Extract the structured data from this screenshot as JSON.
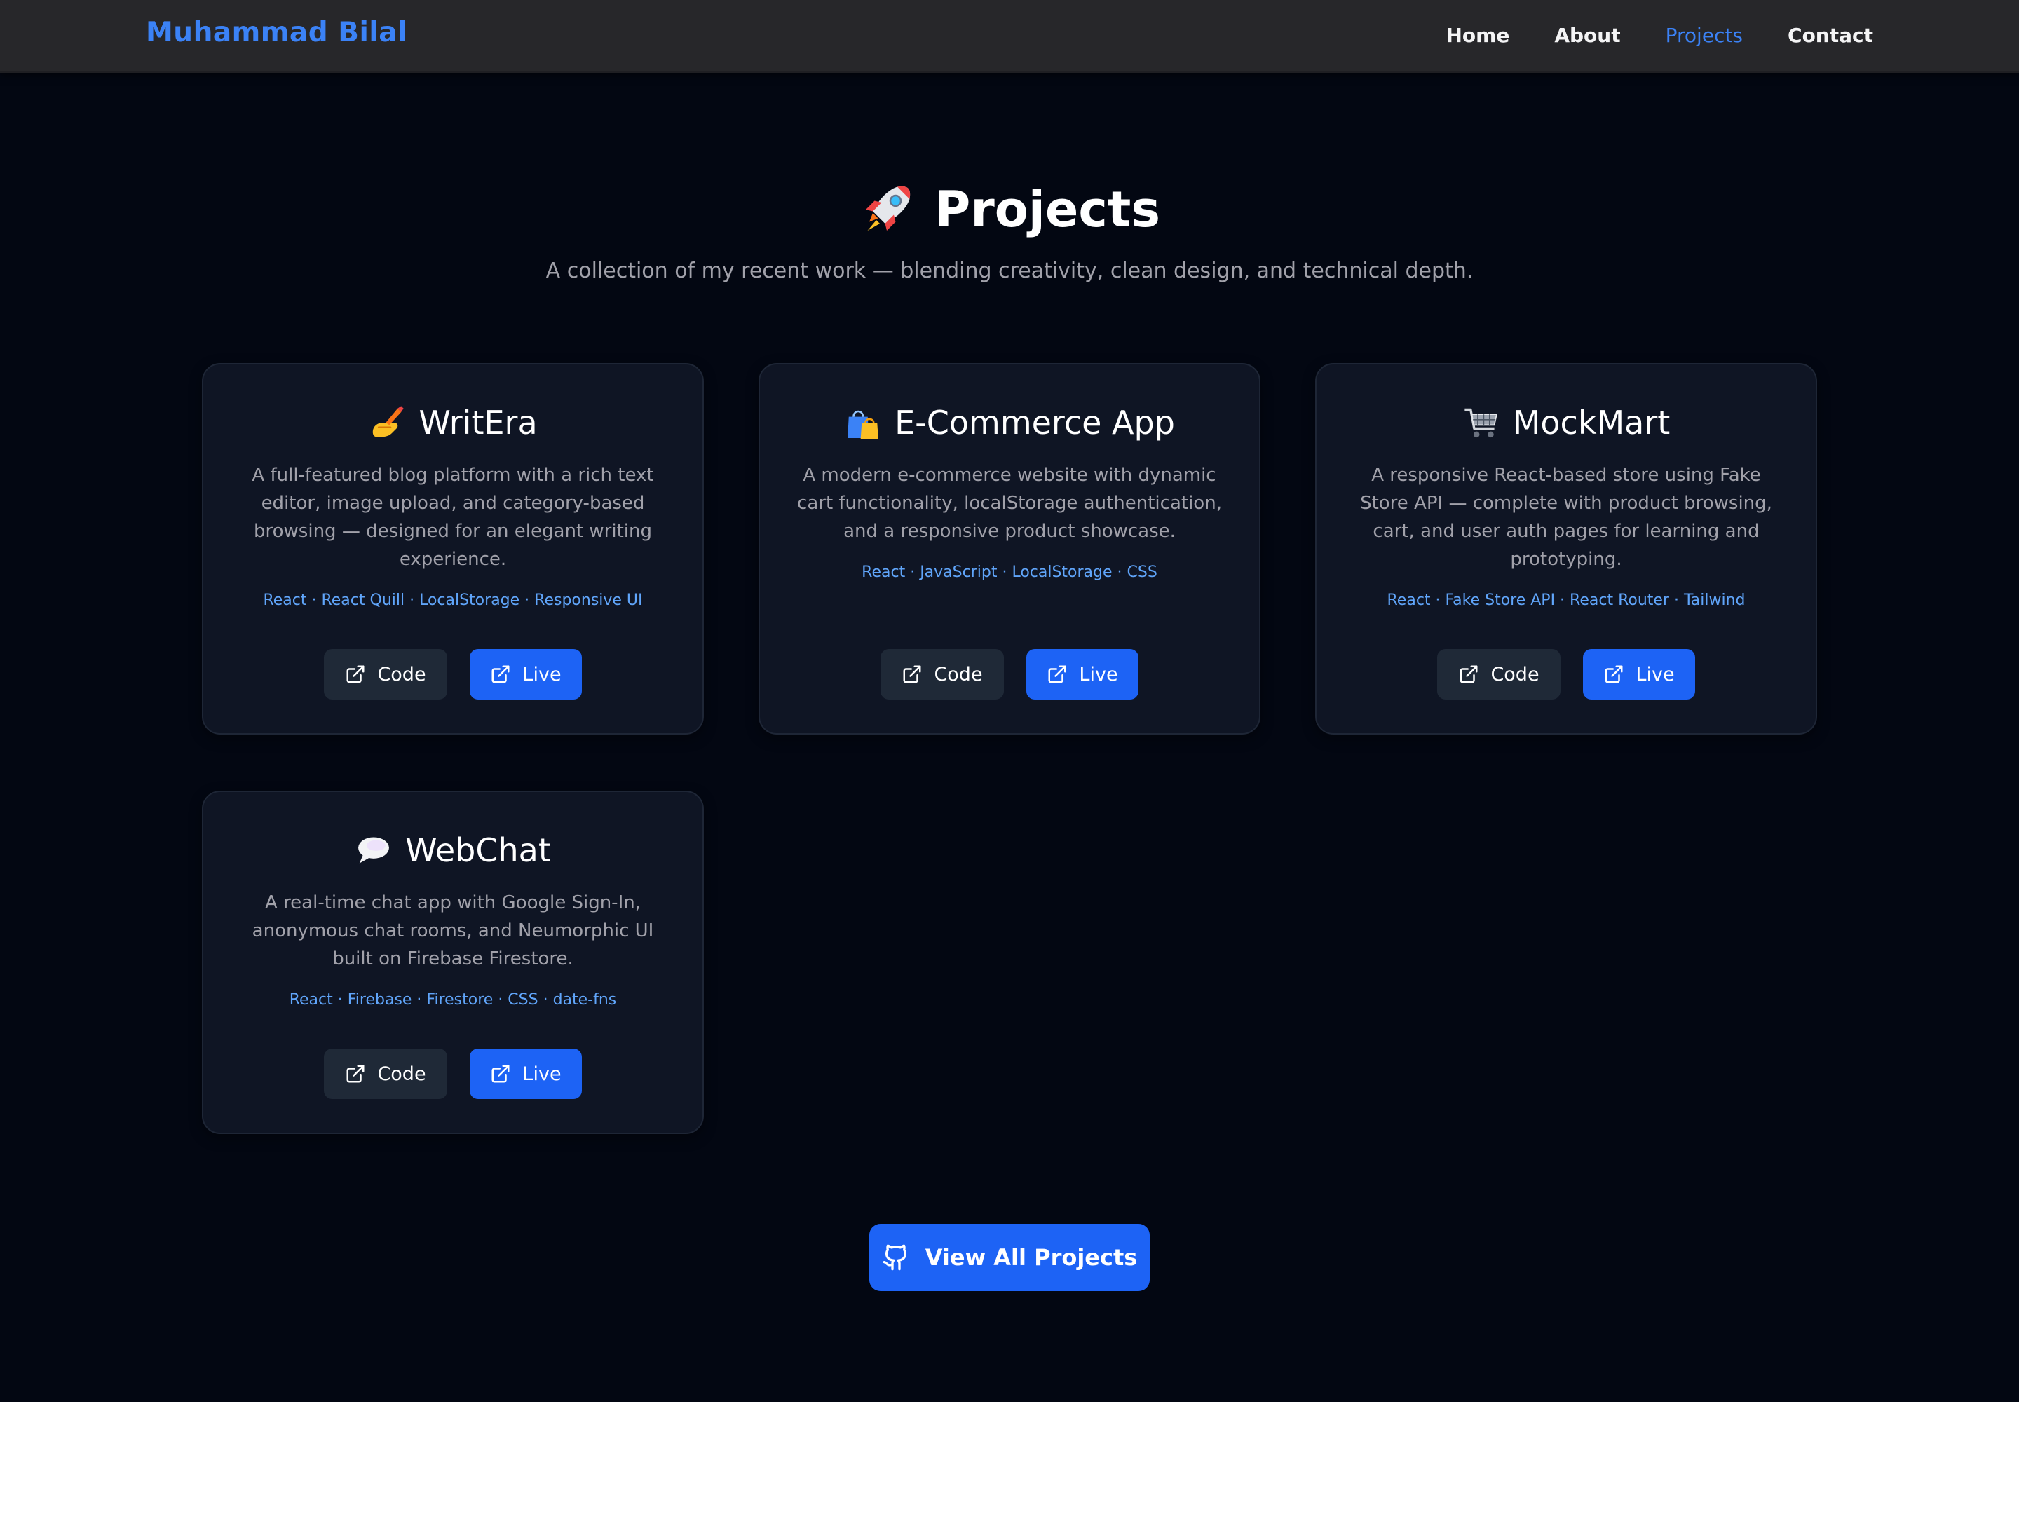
{
  "header": {
    "brand": "Muhammad Bilal",
    "nav": [
      {
        "label": "Home",
        "active": false
      },
      {
        "label": "About",
        "active": false
      },
      {
        "label": "Projects",
        "active": true
      },
      {
        "label": "Contact",
        "active": false
      }
    ]
  },
  "section": {
    "icon": "rocket-icon",
    "title": "Projects",
    "subtitle": "A collection of my recent work — blending creativity, clean design, and technical depth."
  },
  "projects": [
    {
      "icon": "writing-hand-icon",
      "title": "WritEra",
      "description": "A full-featured blog platform with a rich text editor, image upload, and category-based browsing — designed for an elegant writing experience.",
      "tech": "React · React Quill · LocalStorage · Responsive UI",
      "code_label": "Code",
      "live_label": "Live"
    },
    {
      "icon": "shopping-bags-icon",
      "title": "E-Commerce App",
      "description": "A modern e-commerce website with dynamic cart functionality, localStorage authentication, and a responsive product showcase.",
      "tech": "React · JavaScript · LocalStorage · CSS",
      "code_label": "Code",
      "live_label": "Live"
    },
    {
      "icon": "shopping-cart-icon",
      "title": "MockMart",
      "description": "A responsive React-based store using Fake Store API — complete with product browsing, cart, and user auth pages for learning and prototyping.",
      "tech": "React · Fake Store API · React Router · Tailwind",
      "code_label": "Code",
      "live_label": "Live"
    },
    {
      "icon": "speech-bubble-icon",
      "title": "WebChat",
      "description": "A real-time chat app with Google Sign-In, anonymous chat rooms, and Neumorphic UI built on Firebase Firestore.",
      "tech": "React · Firebase · Firestore · CSS · date-fns",
      "code_label": "Code",
      "live_label": "Live"
    }
  ],
  "view_all": {
    "icon": "github-icon",
    "label": "View All Projects"
  },
  "colors": {
    "page_bg": "#030712",
    "header_bg": "#27272a",
    "card_bg": "#0f1524",
    "accent": "#3b82f6",
    "primary_button": "#1d63f5",
    "secondary_button": "#1f2937",
    "tech_text": "#60a5fa",
    "muted_text": "#a1a1aa"
  }
}
